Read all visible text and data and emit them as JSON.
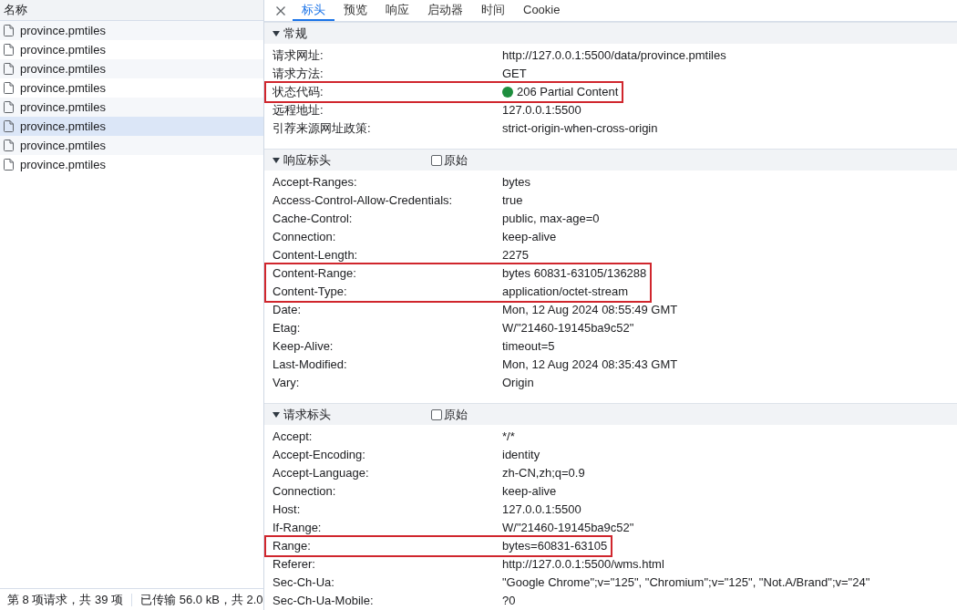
{
  "requests_panel": {
    "column_header": "名称",
    "items": [
      {
        "name": "province.pmtiles",
        "selected": false
      },
      {
        "name": "province.pmtiles",
        "selected": false
      },
      {
        "name": "province.pmtiles",
        "selected": false
      },
      {
        "name": "province.pmtiles",
        "selected": false
      },
      {
        "name": "province.pmtiles",
        "selected": false
      },
      {
        "name": "province.pmtiles",
        "selected": true
      },
      {
        "name": "province.pmtiles",
        "selected": false
      },
      {
        "name": "province.pmtiles",
        "selected": false
      }
    ]
  },
  "status_bar": {
    "requests": "第 8 项请求，共 39 项",
    "transferred": "已传输 56.0 kB，共 2.0"
  },
  "detail_tabs": [
    {
      "label": "标头",
      "selected": true
    },
    {
      "label": "预览",
      "selected": false
    },
    {
      "label": "响应",
      "selected": false
    },
    {
      "label": "启动器",
      "selected": false
    },
    {
      "label": "时间",
      "selected": false
    },
    {
      "label": "Cookie",
      "selected": false
    }
  ],
  "sections": [
    {
      "title": "常规",
      "expanded": true,
      "rows": [
        {
          "name": "请求网址:",
          "value": "http://127.0.0.1:5500/data/province.pmtiles",
          "highlighted": false
        },
        {
          "name": "请求方法:",
          "value": "GET",
          "highlighted": false
        },
        {
          "name": "状态代码:",
          "value": "206 Partial Content",
          "color": "#1e8e3e",
          "highlighted": true
        },
        {
          "name": "远程地址:",
          "value": "127.0.0.1:5500",
          "highlighted": false
        },
        {
          "name": "引荐来源网址政策:",
          "value": "strict-origin-when-cross-origin",
          "highlighted": false
        }
      ]
    },
    {
      "title": "响应标头",
      "expanded": true,
      "raw_checkbox": {
        "label": "原始",
        "checked": false
      },
      "rows": [
        {
          "name": "Accept-Ranges:",
          "value": "bytes",
          "highlighted": false
        },
        {
          "name": "Access-Control-Allow-Credentials:",
          "value": "true",
          "highlighted": false
        },
        {
          "name": "Cache-Control:",
          "value": "public, max-age=0",
          "highlighted": false
        },
        {
          "name": "Connection:",
          "value": "keep-alive",
          "highlighted": false
        },
        {
          "name": "Content-Length:",
          "value": "2275",
          "highlighted": false
        },
        {
          "name": "Content-Range:",
          "value": "bytes 60831-63105/136288",
          "highlighted": true
        },
        {
          "name": "Content-Type:",
          "value": "application/octet-stream",
          "highlighted": true
        },
        {
          "name": "Date:",
          "value": "Mon, 12 Aug 2024 08:55:49 GMT",
          "highlighted": false
        },
        {
          "name": "Etag:",
          "value": "W/\"21460-19145ba9c52\"",
          "highlighted": false
        },
        {
          "name": "Keep-Alive:",
          "value": "timeout=5",
          "highlighted": false
        },
        {
          "name": "Last-Modified:",
          "value": "Mon, 12 Aug 2024 08:35:43 GMT",
          "highlighted": false
        },
        {
          "name": "Vary:",
          "value": "Origin",
          "highlighted": false
        }
      ]
    },
    {
      "title": "请求标头",
      "expanded": true,
      "raw_checkbox": {
        "label": "原始",
        "checked": false
      },
      "rows": [
        {
          "name": "Accept:",
          "value": "*/*",
          "highlighted": false
        },
        {
          "name": "Accept-Encoding:",
          "value": "identity",
          "highlighted": false
        },
        {
          "name": "Accept-Language:",
          "value": "zh-CN,zh;q=0.9",
          "highlighted": false
        },
        {
          "name": "Connection:",
          "value": "keep-alive",
          "highlighted": false
        },
        {
          "name": "Host:",
          "value": "127.0.0.1:5500",
          "highlighted": false
        },
        {
          "name": "If-Range:",
          "value": "W/\"21460-19145ba9c52\"",
          "highlighted": false
        },
        {
          "name": "Range:",
          "value": "bytes=60831-63105",
          "highlighted": true
        },
        {
          "name": "Referer:",
          "value": "http://127.0.0.1:5500/wms.html",
          "highlighted": false
        },
        {
          "name": "Sec-Ch-Ua:",
          "value": "\"Google Chrome\";v=\"125\", \"Chromium\";v=\"125\", \"Not.A/Brand\";v=\"24\"",
          "highlighted": false
        },
        {
          "name": "Sec-Ch-Ua-Mobile:",
          "value": "?0",
          "highlighted": false
        }
      ]
    }
  ]
}
